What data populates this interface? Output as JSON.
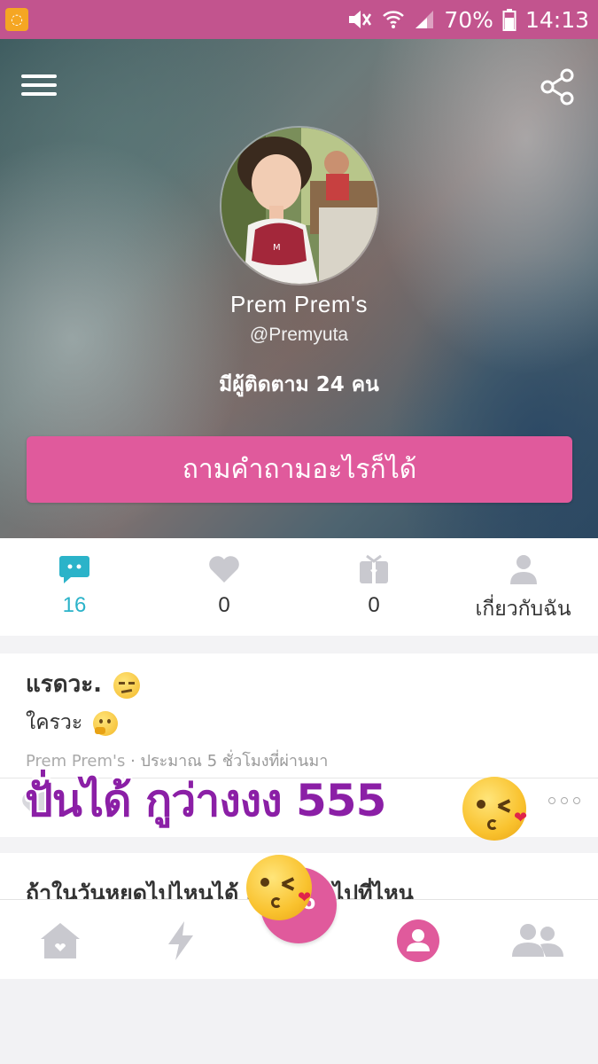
{
  "status_bar": {
    "battery": "70%",
    "time": "14:13"
  },
  "profile": {
    "name": "Prem Prem's",
    "handle": "@Premyuta",
    "followers": "มีผู้ติดตาม 24 คน",
    "ask_button": "ถามคำถามอะไรก็ได้"
  },
  "tabs": [
    {
      "icon": "answers-icon",
      "value": "16",
      "active": true
    },
    {
      "icon": "heart-icon",
      "value": "0"
    },
    {
      "icon": "gift-icon",
      "value": "0"
    },
    {
      "icon": "person-icon",
      "value": "เกี่ยวกับฉัน"
    }
  ],
  "feed": {
    "question": "แรดวะ.",
    "answer": "ใครวะ",
    "author": "Prem Prem's",
    "time_ago": "· ประมาณ 5 ชั่วโมงที่ผ่านมา",
    "next_question": "ถ้าในวันหยุดไปไหนได้ เธออยากไปที่ไหน"
  },
  "overlay": {
    "caption": "ปั่นได้ กูว่างงง 555"
  },
  "bottom_nav": {
    "items": [
      "home-icon",
      "bolt-icon",
      "ask-fab",
      "profile-icon",
      "friends-icon"
    ],
    "fab_label": "o,o"
  },
  "colors": {
    "brand_pink": "#e05a9c",
    "status_bar": "#c2548e",
    "active_teal": "#2bb3c9",
    "overlay_purple": "#8b1fa6"
  }
}
